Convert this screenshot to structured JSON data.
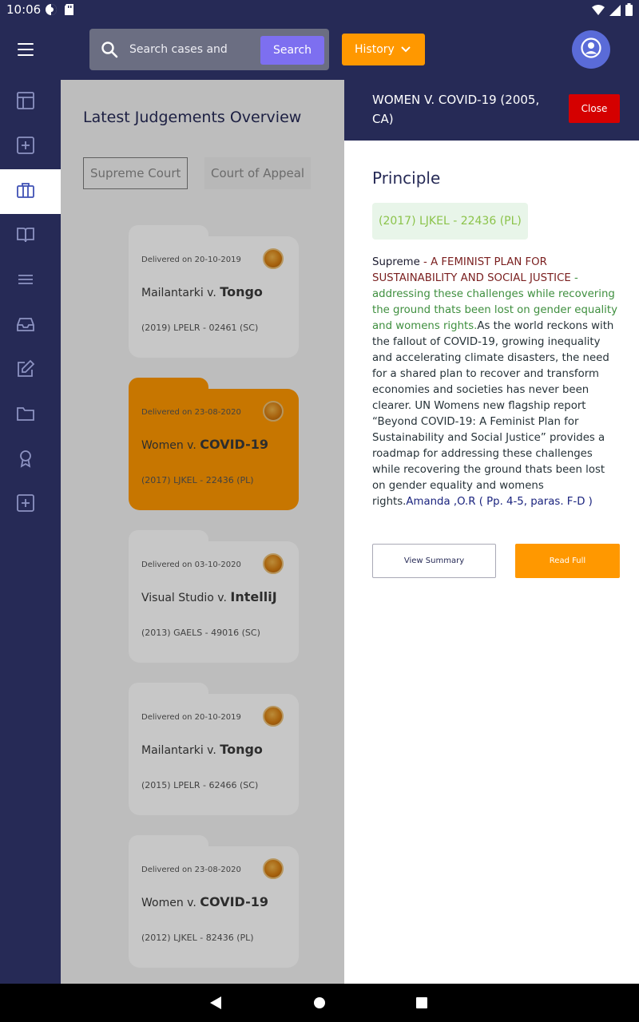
{
  "status_bar": {
    "time": "10:06"
  },
  "search": {
    "placeholder": "Search cases and",
    "button_label": "Search"
  },
  "history": {
    "label": "History"
  },
  "sidebar": {
    "items": [
      {
        "icon": "dashboard-icon"
      },
      {
        "icon": "add-box-icon"
      },
      {
        "icon": "briefcase-icon",
        "active": true
      },
      {
        "icon": "book-icon"
      },
      {
        "icon": "list-icon"
      },
      {
        "icon": "inbox-icon"
      },
      {
        "icon": "edit-icon"
      },
      {
        "icon": "folder-icon"
      },
      {
        "icon": "award-icon"
      },
      {
        "icon": "add-box-icon"
      }
    ]
  },
  "main": {
    "title": "Latest Judgements Overview",
    "tabs": [
      "Supreme Court",
      "Court of Appeal"
    ],
    "cards": [
      {
        "delivered": "Delivered on 20-10-2019",
        "party1": "Mailantarki",
        "vs": "v.",
        "party2": "Tongo",
        "citation": "(2019) LPELR - 02461 (SC)",
        "highlighted": false
      },
      {
        "delivered": "Delivered on 23-08-2020",
        "party1": "Women",
        "vs": "v.",
        "party2": "COVID-19",
        "citation": "(2017) LJKEL - 22436 (PL)",
        "highlighted": true
      },
      {
        "delivered": "Delivered on 03-10-2020",
        "party1": "Visual Studio",
        "vs": "v.",
        "party2": "IntelliJ",
        "citation": "(2013) GAELS - 49016 (SC)",
        "highlighted": false
      },
      {
        "delivered": "Delivered on 20-10-2019",
        "party1": "Mailantarki",
        "vs": "v.",
        "party2": "Tongo",
        "citation": "(2015) LPELR - 62466 (SC)",
        "highlighted": false
      },
      {
        "delivered": "Delivered on 23-08-2020",
        "party1": "Women",
        "vs": "v.",
        "party2": "COVID-19",
        "citation": "(2012) LJKEL - 82436 (PL)",
        "highlighted": false
      }
    ]
  },
  "panel": {
    "title": "WOMEN V. COVID-19 (2005, CA)",
    "close_label": "Close",
    "heading": "Principle",
    "citation_pill": "(2017) LJKEL - 22436 (PL)",
    "court": "Supreme",
    "separator": " - ",
    "red_text": "A FEMINIST PLAN FOR SUSTAINABILITY AND SOCIAL JUSTICE",
    "green_text": "addressing these challenges while recovering the ground thats been lost on gender equality and womens rights.",
    "body_text": "As the world reckons with the fallout of COVID-19, growing inequality and accelerating climate disasters, the need for a shared plan to recover and transform economies and societies has never been clearer. UN Womens new flagship report “Beyond COVID-19: A Feminist Plan for Sustainability and Social Justice” provides a roadmap for addressing these challenges while recovering the ground thats been lost on gender equality and womens rights.",
    "author": "Amanda ,O.R ( Pp. 4-5, paras. F-D )",
    "view_summary_label": "View Summary",
    "read_full_label": "Read Full"
  },
  "colors": {
    "primary": "#262a56",
    "accent": "#ff9800",
    "danger": "#d50000",
    "search_button": "#7d6ff0"
  }
}
